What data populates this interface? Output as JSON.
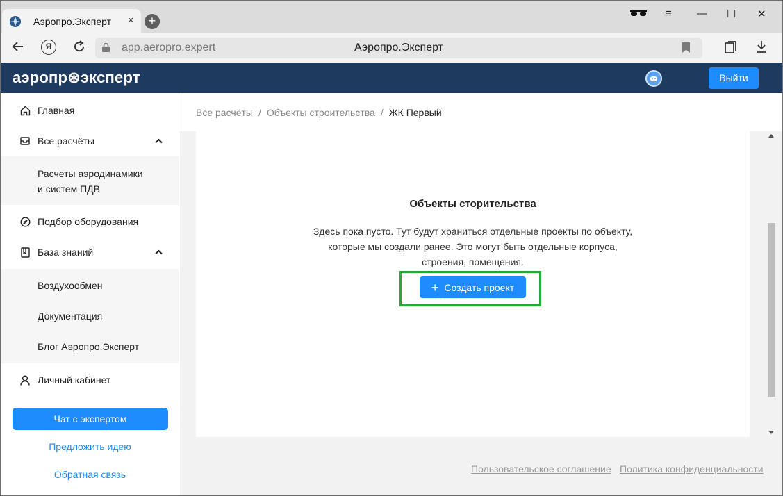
{
  "browser": {
    "tab_title": "Аэропро.Эксперт",
    "tab_close": "×",
    "new_tab": "+",
    "url": "app.aeropro.expert",
    "page_title": "Аэропро.Эксперт",
    "ya_label": "Я",
    "window_controls": {
      "minimize": "—",
      "maximize": "☐",
      "close": "✕",
      "menu": "≡"
    }
  },
  "header": {
    "logo": "аэропр⊛эксперт",
    "logout_label": "Выйти"
  },
  "sidebar": {
    "home": "Главная",
    "all_calcs": "Все расчёты",
    "all_calcs_sub": [
      "Расчеты аэродинамики",
      "и систем ПДВ"
    ],
    "equipment": "Подбор оборудования",
    "knowledge": "База знаний",
    "knowledge_sub": [
      "Воздухообмен",
      "Документация",
      "Блог Аэропро.Эксперт"
    ],
    "cabinet": "Личный кабинет",
    "chat_button": "Чат с экспертом",
    "suggest_link": "Предложить идею",
    "feedback_link": "Обратная связь"
  },
  "breadcrumb": {
    "items": [
      "Все расчёты",
      "Объекты строительства",
      "ЖК Первый"
    ],
    "separator": "/"
  },
  "card": {
    "title": "Объекты сторительства",
    "desc_line1": "Здесь пока пусто. Тут будут храниться отдельные проекты по объекту,",
    "desc_line2": "которые мы создали ранее. Это могут быть отдельные корпуса,",
    "desc_line3": "строения, помещения.",
    "create_button": "Создать проект",
    "create_plus": "+"
  },
  "footer": {
    "agreement": "Пользовательское соглашение",
    "privacy": "Политика конфиденциальности"
  },
  "colors": {
    "accent": "#1e8cff",
    "header_bg": "#1e3a5f",
    "highlight": "#2ca836"
  }
}
